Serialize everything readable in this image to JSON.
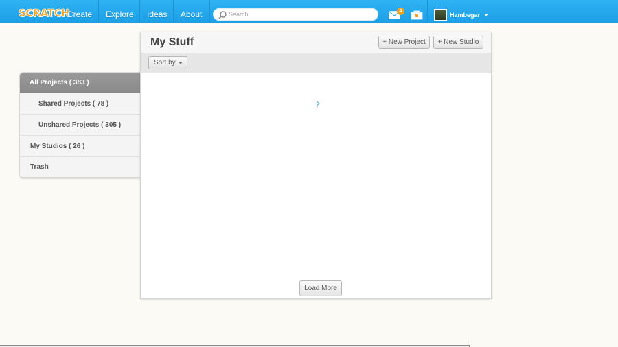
{
  "header": {
    "logo_text": "SCRATCH",
    "nav": [
      "Create",
      "Explore",
      "Ideas",
      "About"
    ],
    "search": {
      "placeholder": "Search"
    },
    "messages_count": "4",
    "username": "Hambegar",
    "icons": [
      "search-icon",
      "mail-icon",
      "my-stuff-icon",
      "chevron-down-icon"
    ],
    "colors": {
      "bar": "#25aff4",
      "badge": "#f9a11b"
    }
  },
  "sidebar": {
    "items": [
      {
        "label": "All Projects ( 383 )",
        "active": true
      },
      {
        "label": "Shared Projects ( 78 )",
        "active": false
      },
      {
        "label": "Unshared Projects ( 305 )",
        "active": false
      },
      {
        "label": "My Studios ( 26 )",
        "active": false
      },
      {
        "label": "Trash",
        "active": false
      }
    ]
  },
  "main": {
    "title": "My Stuff",
    "new_project_label": "+ New Project",
    "new_studio_label": "+ New Studio",
    "sort_label": "Sort by",
    "load_more_label": "Load More"
  }
}
